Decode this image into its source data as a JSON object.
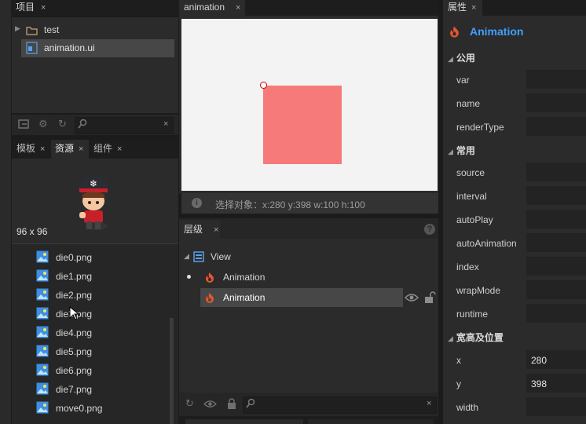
{
  "project_panel": {
    "tab_label": "项目",
    "folder": "test",
    "file": "animation.ui"
  },
  "assets_panel": {
    "tabs": [
      "模板",
      "资源",
      "组件"
    ],
    "preview_size": "96 x 96",
    "files": [
      "die0.png",
      "die1.png",
      "die2.png",
      "die3.png",
      "die4.png",
      "die5.png",
      "die6.png",
      "die7.png",
      "move0.png"
    ]
  },
  "editor": {
    "tab_label": "animation",
    "status": "选择对象：x:280 y:398  w:100 h:100"
  },
  "layers_panel": {
    "tab_label": "层级",
    "help": "?",
    "root": "View",
    "items": [
      "Animation",
      "Animation"
    ]
  },
  "properties_panel": {
    "tab_label": "属性",
    "component_name": "Animation",
    "sections": {
      "common": "公用",
      "frequent": "常用",
      "size_position": "宽高及位置"
    },
    "common_props": [
      "var",
      "name",
      "renderType"
    ],
    "frequent_props": [
      "source",
      "interval",
      "autoPlay",
      "autoAnimation",
      "index",
      "wrapMode",
      "runtime"
    ],
    "position_props": [
      {
        "label": "x",
        "value": "280"
      },
      {
        "label": "y",
        "value": "398"
      },
      {
        "label": "width",
        "value": ""
      }
    ]
  },
  "colors": {
    "accent_blue": "#3fa0ff",
    "animation_box": "#f77a7a",
    "flame": "#e4572e"
  },
  "close_glyph": "×"
}
